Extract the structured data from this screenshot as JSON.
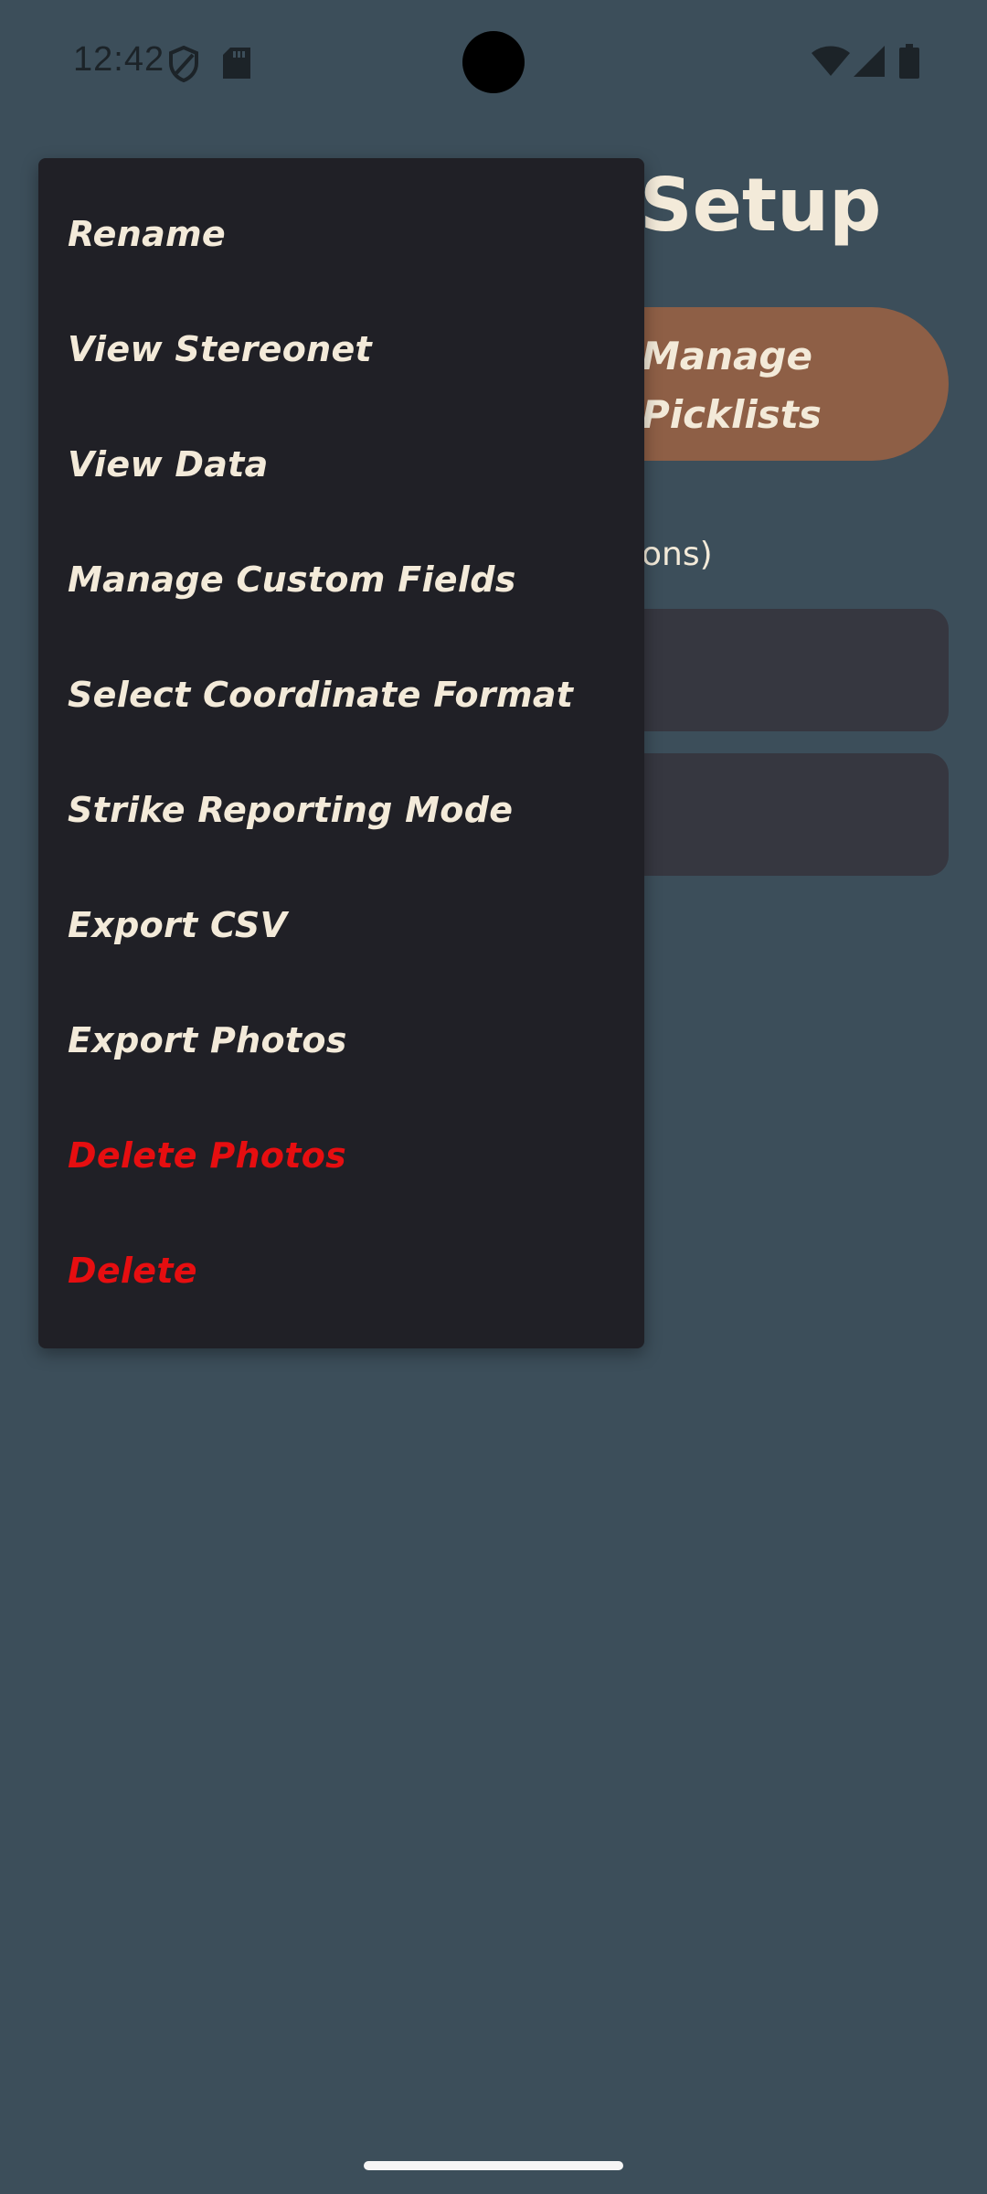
{
  "status_bar": {
    "time": "12:42",
    "icons": [
      "shield-icon",
      "sd-card-icon",
      "wifi-icon",
      "cellular-signal-icon",
      "battery-icon"
    ]
  },
  "background_screen": {
    "title_visible": "Setup",
    "picklists_button_label": "Manage\nPicklists",
    "section_hint_visible": "ons)"
  },
  "menu": {
    "items": [
      {
        "label": "Rename"
      },
      {
        "label": "View Stereonet"
      },
      {
        "label": "View Data"
      },
      {
        "label": "Manage Custom Fields"
      },
      {
        "label": "Select Coordinate Format"
      },
      {
        "label": "Strike Reporting Mode"
      },
      {
        "label": "Export CSV"
      },
      {
        "label": "Export Photos"
      },
      {
        "label": "Delete Photos"
      },
      {
        "label": "Delete"
      }
    ]
  },
  "colors": {
    "background": "#3c4e5a",
    "menu_background": "#202026",
    "menu_text": "#f3ead9",
    "danger_text": "#e60e10",
    "accent_button": "#8e5f46",
    "card": "#363740"
  }
}
